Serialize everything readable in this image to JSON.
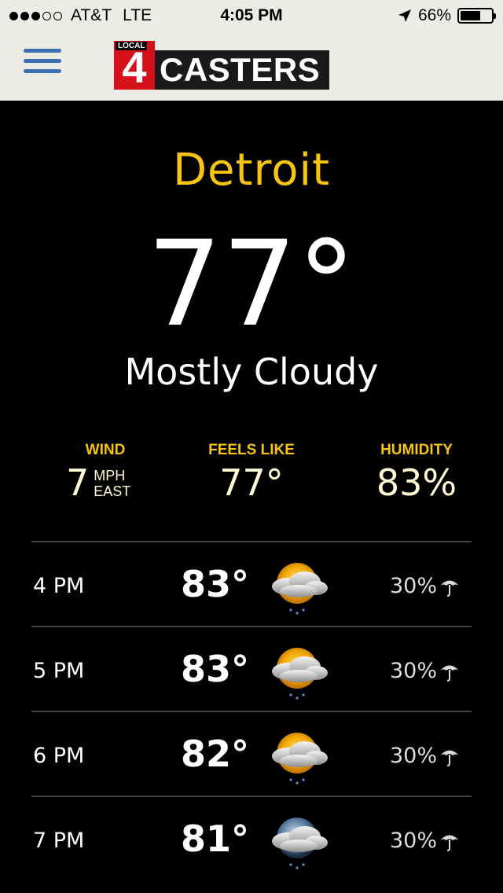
{
  "status_bar": {
    "carrier": "AT&T",
    "network": "LTE",
    "time": "4:05 PM",
    "battery": "66%",
    "battery_level": 0.66,
    "signal_bars": 3,
    "signal_max": 5
  },
  "header": {
    "logo_local": "LOCAL",
    "logo_number": "4",
    "logo_word": "CASTERS"
  },
  "current": {
    "city": "Detroit",
    "temp": "77°",
    "condition": "Mostly Cloudy"
  },
  "stats": {
    "wind_label": "WIND",
    "wind_value": "7",
    "wind_unit": "MPH",
    "wind_dir": "EAST",
    "feels_label": "FEELS LIKE",
    "feels_value": "77°",
    "humidity_label": "HUMIDITY",
    "humidity_value": "83%"
  },
  "hourly": [
    {
      "hour": "4 PM",
      "temp": "83°",
      "precip": "30%",
      "icon": "partly-cloudy-day-rain-icon"
    },
    {
      "hour": "5 PM",
      "temp": "83°",
      "precip": "30%",
      "icon": "partly-cloudy-day-rain-icon"
    },
    {
      "hour": "6 PM",
      "temp": "82°",
      "precip": "30%",
      "icon": "partly-cloudy-day-rain-icon"
    },
    {
      "hour": "7 PM",
      "temp": "81°",
      "precip": "30%",
      "icon": "partly-cloudy-night-rain-icon"
    }
  ],
  "colors": {
    "accent": "#f7c414",
    "menu": "#3a6fb0",
    "logo_red": "#d5121c",
    "bar_bg": "#ecebe6"
  }
}
